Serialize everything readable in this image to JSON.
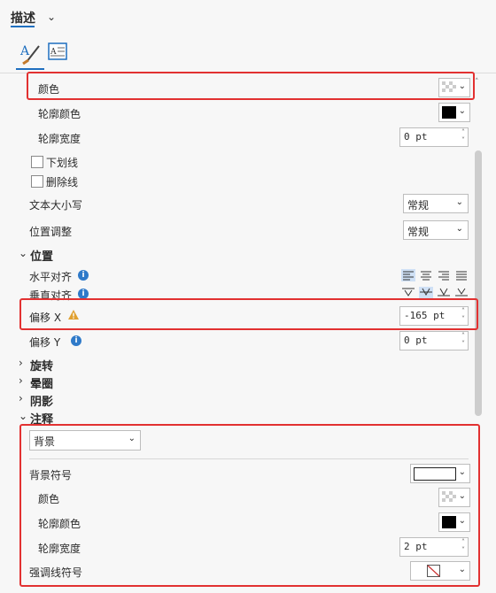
{
  "header": {
    "title": "描述"
  },
  "rows": {
    "color": "颜色",
    "outline_color": "轮廓颜色",
    "outline_width": "轮廓宽度",
    "outline_width_value": "0 pt",
    "underline": "下划线",
    "strikethrough": "删除线",
    "text_case": "文本大小写",
    "text_case_value": "常规",
    "position_adjust": "位置调整",
    "position_adjust_value": "常规"
  },
  "position_section": {
    "title": "位置",
    "h_align": "水平对齐",
    "v_align": "垂直对齐",
    "offset_x": "偏移 X",
    "offset_x_value": "-165 pt",
    "offset_y": "偏移 Y",
    "offset_y_value": "0 pt"
  },
  "collapsed_sections": [
    "旋转",
    "晕圈",
    "阴影"
  ],
  "callout_section": {
    "title": "注释",
    "type_value": "背景",
    "bg_symbol": "背景符号",
    "color": "颜色",
    "outline_color": "轮廓颜色",
    "outline_width": "轮廓宽度",
    "outline_width_value": "2 pt",
    "accent_symbol": "强调线符号"
  },
  "colors": {
    "accent": "#1f6fbf",
    "highlight": "#e23131",
    "info": "#2f7ac9",
    "warning": "#e0a030"
  },
  "icons": [
    "text-symbol-tab-icon",
    "text-frame-tab-icon",
    "info-icon",
    "warning-icon"
  ]
}
